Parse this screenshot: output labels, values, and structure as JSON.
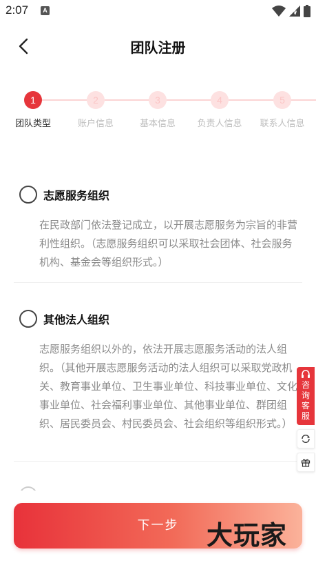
{
  "status_bar": {
    "time": "2:07",
    "notif_badge": "A"
  },
  "header": {
    "title": "团队注册"
  },
  "stepper": {
    "steps": [
      {
        "number": "1",
        "label": "团队类型"
      },
      {
        "number": "2",
        "label": "账户信息"
      },
      {
        "number": "3",
        "label": "基本信息"
      },
      {
        "number": "4",
        "label": "负责人信息"
      },
      {
        "number": "5",
        "label": "联系人信息"
      }
    ],
    "active_index": 0
  },
  "options": [
    {
      "title": "志愿服务组织",
      "description": "在民政部门依法登记成立，以开展志愿服务为宗旨的非营利性组织。（志愿服务组织可以采取社会团体、社会服务机构、基金会等组织形式。）"
    },
    {
      "title": "其他法人组织",
      "description": "志愿服务组织以外的，依法开展志愿服务活动的法人组织。（其他开展志愿服务活动的法人组织可以采取党政机关、教育事业单位、卫生事业单位、科技事业单位、文化事业单位、社会福利事业单位、其他事业单位、群团组织、居民委员会、村民委员会、社会组织等组织形式。）"
    }
  ],
  "side_float": {
    "consult_label": "咨询客服"
  },
  "footer": {
    "next_label": "下一步"
  },
  "watermark": "大玩家",
  "colors": {
    "accent": "#e6353b"
  }
}
